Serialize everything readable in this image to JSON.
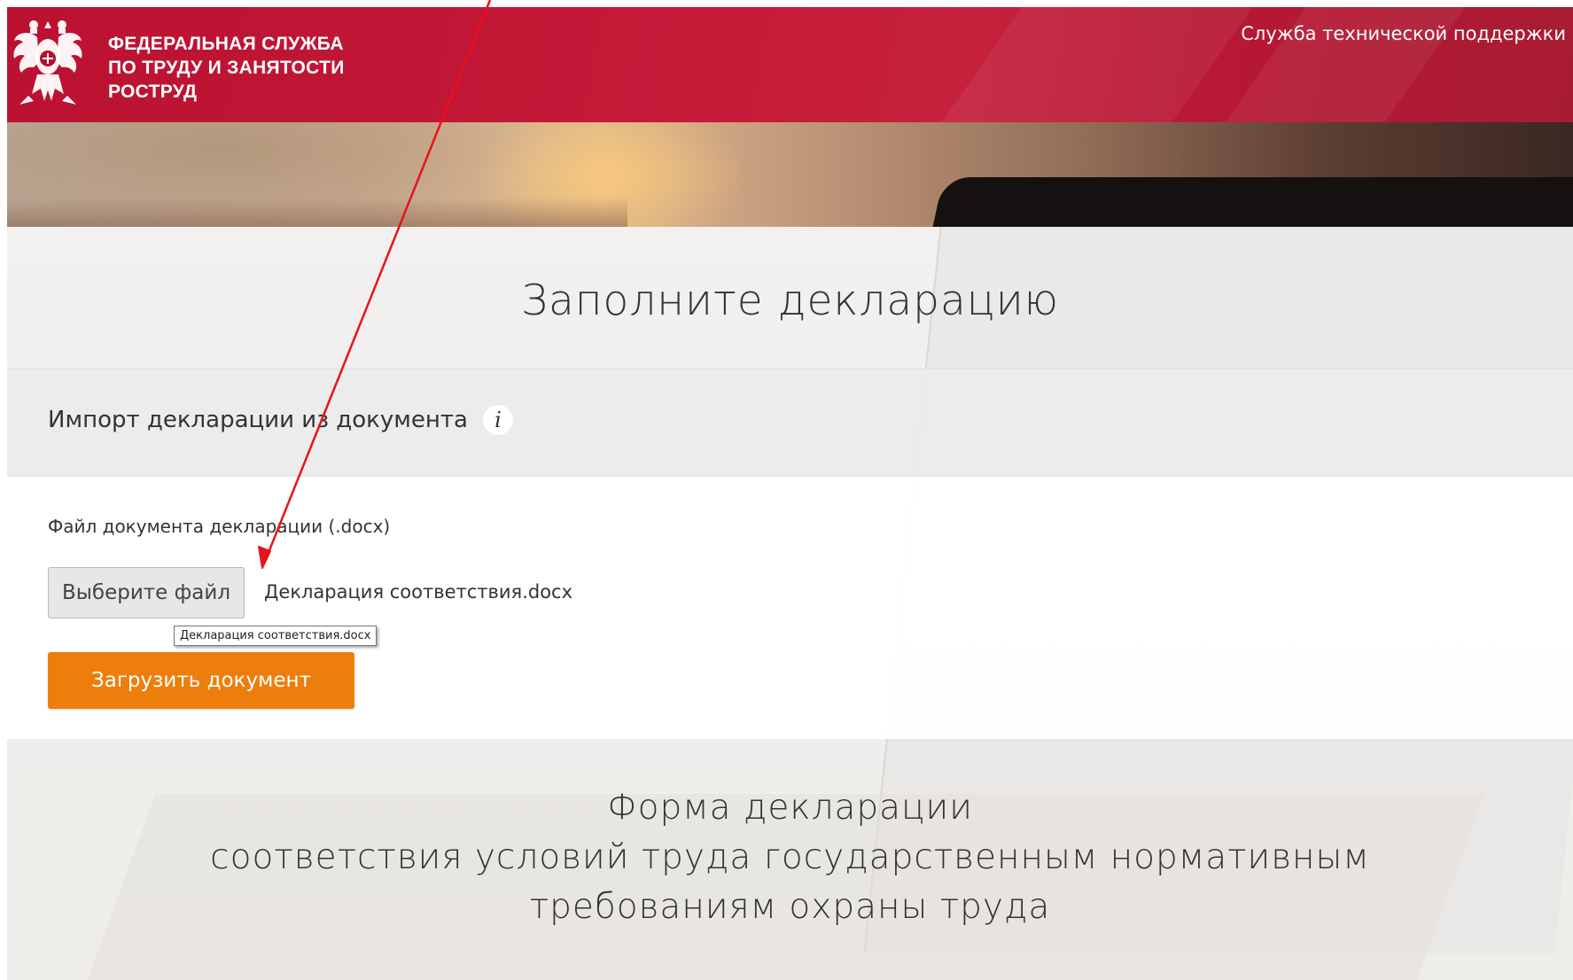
{
  "header": {
    "org_line1": "ФЕДЕРАЛЬНАЯ СЛУЖБА",
    "org_line2": "ПО ТРУДУ И ЗАНЯТОСТИ",
    "org_line3": "РОСТРУД",
    "support_link": "Служба технической поддержки",
    "brand_color": "#c01a37"
  },
  "main": {
    "page_title": "Заполните декларацию",
    "import": {
      "title": "Импорт декларации из документа",
      "info_icon": "i",
      "file_label": "Файл документа декларации (.docx)",
      "choose_button": "Выберите файл",
      "selected_file": "Декларация соответствия.docx",
      "tooltip": "Декларация соответствия.docx",
      "upload_button": "Загрузить документ",
      "upload_color": "#ee7e0b"
    },
    "form_title": {
      "line1": "Форма декларации",
      "line2": "соответствия условий труда государственным нормативным",
      "line3": "требованиям охраны труда"
    }
  },
  "annotation": {
    "color": "#e8121c",
    "icon": "red-arrow"
  }
}
